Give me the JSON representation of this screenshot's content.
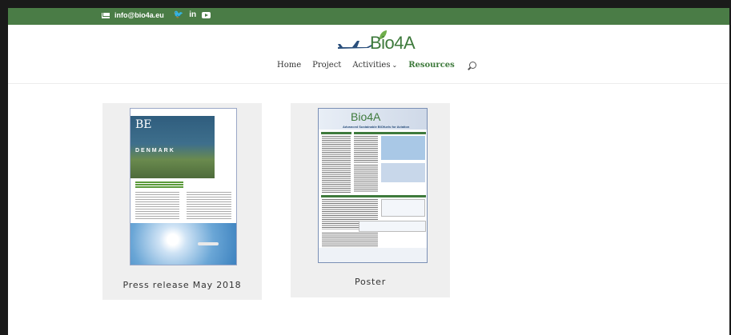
{
  "topbar": {
    "email": "info@bio4a.eu",
    "social": [
      "twitter-icon",
      "linkedin-icon",
      "youtube-icon"
    ],
    "twitter_glyph": "🐦",
    "linkedin_glyph": "in"
  },
  "header": {
    "logo_text": "Bio4A",
    "nav": [
      {
        "label": "Home"
      },
      {
        "label": "Project"
      },
      {
        "label": "Activities",
        "chevron": "⌄"
      },
      {
        "label": "Resources",
        "active": true
      }
    ]
  },
  "cards": [
    {
      "caption": "Press release May 2018",
      "thumb": {
        "masthead": "BE",
        "country": "DENMARK"
      }
    },
    {
      "caption": "Poster",
      "thumb": {
        "logo": "Bio4A",
        "subtitle": "Advanced Sustainable BIOfuels for Aviation"
      }
    }
  ],
  "colors": {
    "brand_green": "#4a7c46",
    "nav_active": "#3e7a3c",
    "card_bg": "#efefef"
  }
}
